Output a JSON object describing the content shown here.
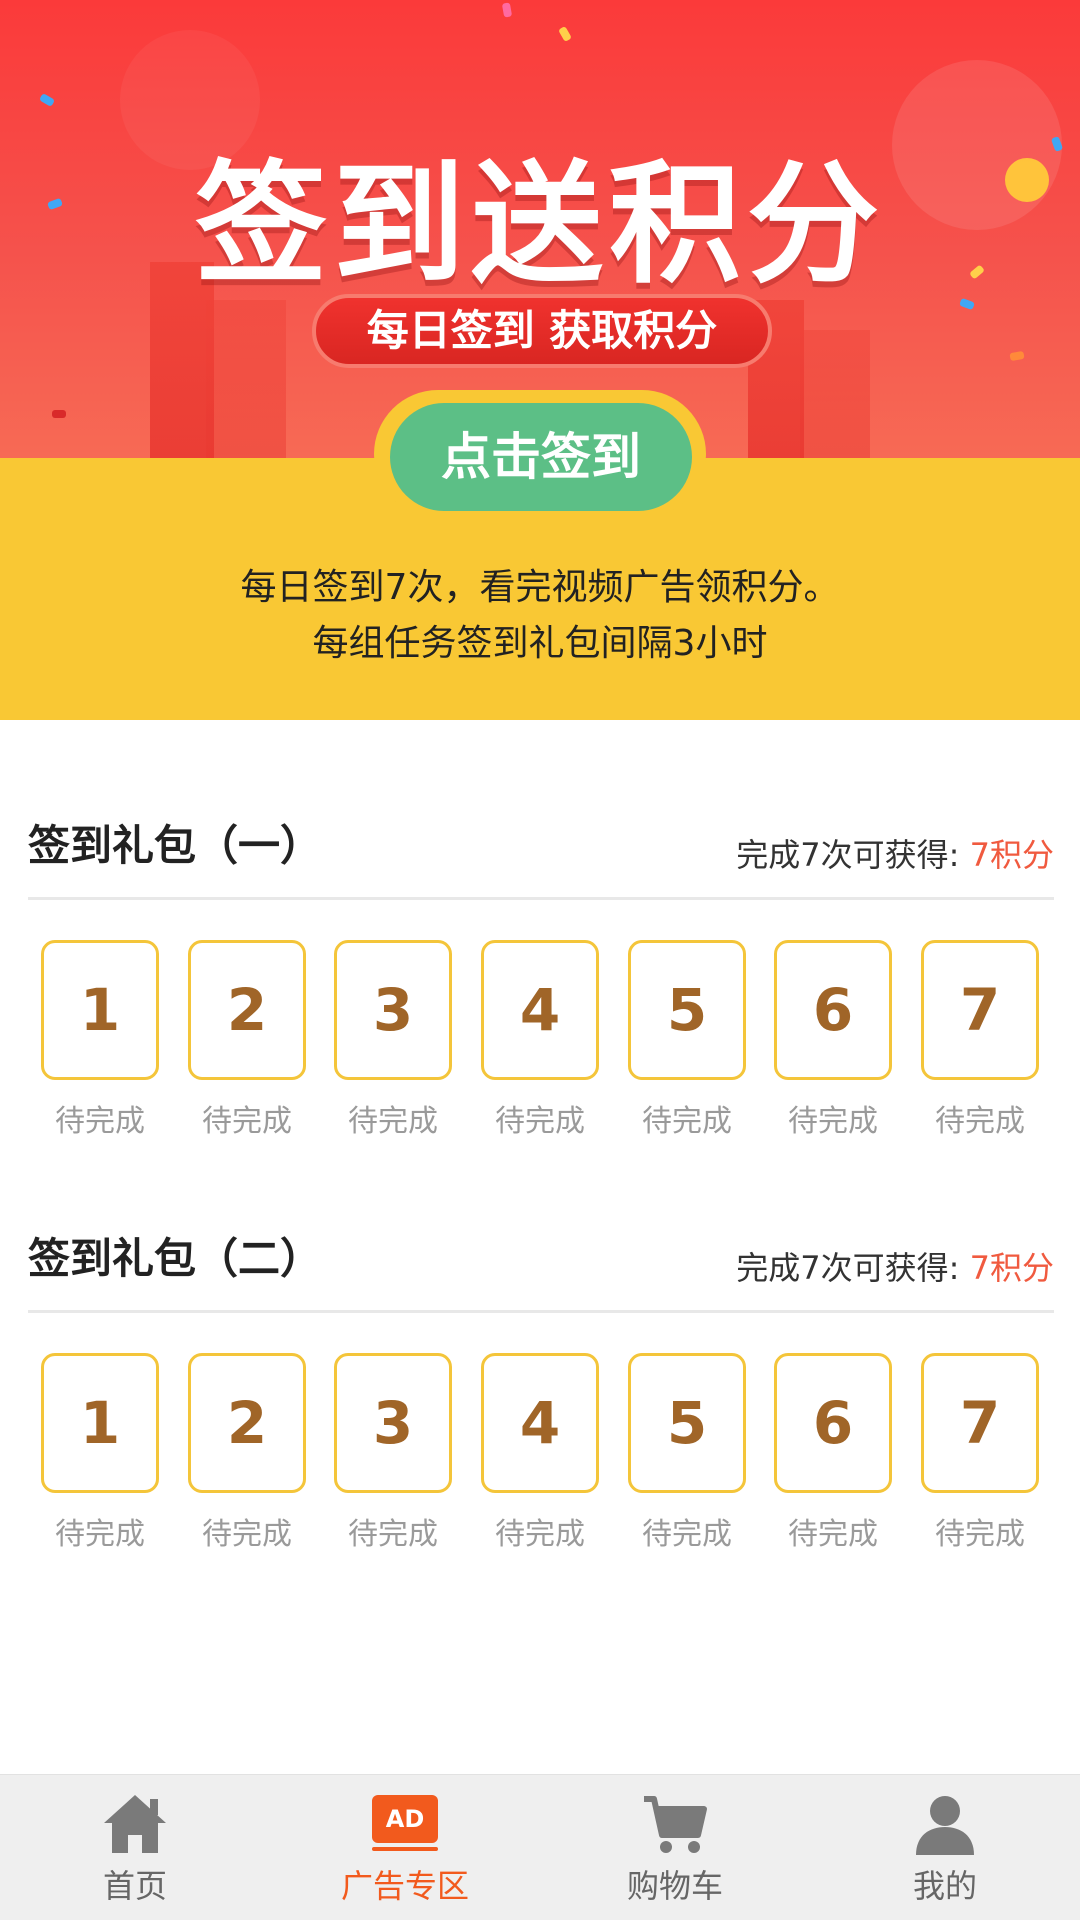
{
  "banner": {
    "title": "签到送积分",
    "subtitle": "每日签到 获取积分",
    "signin_button": "点击签到"
  },
  "info": {
    "line1": "每日签到7次，看完视频广告领积分。",
    "line2": "每组任务签到礼包间隔3小时"
  },
  "sections": [
    {
      "title": "签到礼包（一）",
      "reward_prefix": "完成7次可获得:",
      "reward_points": "7积分",
      "days": [
        {
          "num": "1",
          "status": "待完成"
        },
        {
          "num": "2",
          "status": "待完成"
        },
        {
          "num": "3",
          "status": "待完成"
        },
        {
          "num": "4",
          "status": "待完成"
        },
        {
          "num": "5",
          "status": "待完成"
        },
        {
          "num": "6",
          "status": "待完成"
        },
        {
          "num": "7",
          "status": "待完成"
        }
      ]
    },
    {
      "title": "签到礼包（二）",
      "reward_prefix": "完成7次可获得:",
      "reward_points": "7积分",
      "days": [
        {
          "num": "1",
          "status": "待完成"
        },
        {
          "num": "2",
          "status": "待完成"
        },
        {
          "num": "3",
          "status": "待完成"
        },
        {
          "num": "4",
          "status": "待完成"
        },
        {
          "num": "5",
          "status": "待完成"
        },
        {
          "num": "6",
          "status": "待完成"
        },
        {
          "num": "7",
          "status": "待完成"
        }
      ]
    }
  ],
  "bottom_nav": {
    "items": [
      {
        "label": "首页",
        "icon": "home-icon",
        "active": false
      },
      {
        "label": "广告专区",
        "icon": "ad-icon",
        "badge": "AD",
        "active": true
      },
      {
        "label": "购物车",
        "icon": "cart-icon",
        "active": false
      },
      {
        "label": "我的",
        "icon": "user-icon",
        "active": false
      }
    ]
  },
  "colors": {
    "banner_red": "#fb3a3a",
    "info_yellow": "#f9c834",
    "signin_green": "#5cbf86",
    "day_border": "#f4c53a",
    "day_number": "#a06528",
    "reward_points": "#f05a3f",
    "nav_active": "#f25a1d"
  }
}
